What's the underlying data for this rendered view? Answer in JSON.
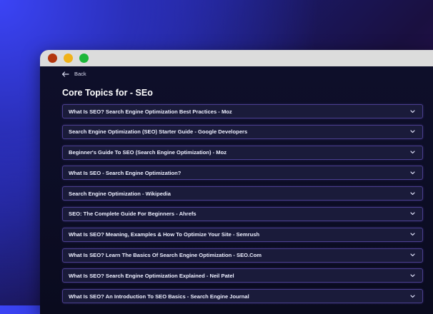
{
  "window": {
    "controls": [
      {
        "name": "close",
        "color": "#b3360f"
      },
      {
        "name": "minimize",
        "color": "#f0b21a"
      },
      {
        "name": "maximize",
        "color": "#1db73a"
      }
    ]
  },
  "nav": {
    "back_label": "Back",
    "back_icon": "arrow-left-icon"
  },
  "page": {
    "title": "Core Topics for - SEo"
  },
  "topics": [
    {
      "label": "What Is SEO? Search Engine Optimization Best Practices - Moz",
      "icon": "chevron-down-icon"
    },
    {
      "label": "Search Engine Optimization (SEO) Starter Guide - Google Developers",
      "icon": "chevron-down-icon"
    },
    {
      "label": "Beginner's Guide To SEO (Search Engine Optimization) - Moz",
      "icon": "chevron-down-icon"
    },
    {
      "label": "What Is SEO - Search Engine Optimization?",
      "icon": "chevron-down-icon"
    },
    {
      "label": "Search Engine Optimization - Wikipedia",
      "icon": "chevron-down-icon"
    },
    {
      "label": "SEO: The Complete Guide For Beginners - Ahrefs",
      "icon": "chevron-down-icon"
    },
    {
      "label": "What Is SEO? Meaning, Examples & How To Optimize Your Site - Semrush",
      "icon": "chevron-down-icon"
    },
    {
      "label": "What Is SEO? Learn The Basics Of Search Engine Optimization - SEO.Com",
      "icon": "chevron-down-icon"
    },
    {
      "label": "What Is SEO? Search Engine Optimization Explained - Neil Patel",
      "icon": "chevron-down-icon"
    },
    {
      "label": "What Is SEO? An Introduction To SEO Basics - Search Engine Journal",
      "icon": "chevron-down-icon"
    }
  ],
  "colors": {
    "accent_border": "#4b3f8f",
    "item_bg": "#1a1b3a",
    "page_bg": "#0a0b1e"
  }
}
